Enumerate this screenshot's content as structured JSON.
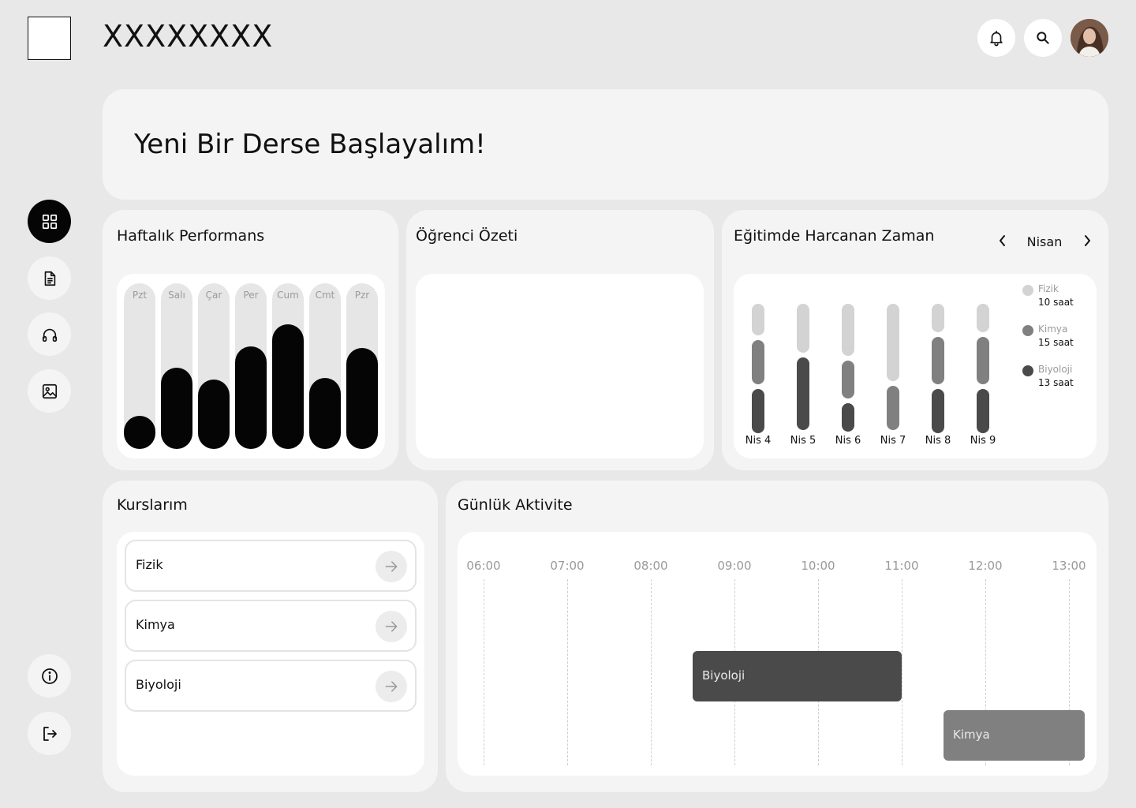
{
  "header": {
    "app_title": "XXXXXXXX",
    "icons": [
      "bell-icon",
      "search-icon"
    ]
  },
  "sidebar": {
    "items": [
      {
        "name": "dashboard",
        "icon": "grid-icon",
        "active": true
      },
      {
        "name": "documents",
        "icon": "document-icon",
        "active": false
      },
      {
        "name": "audio",
        "icon": "headphones-icon",
        "active": false
      },
      {
        "name": "gallery",
        "icon": "image-icon",
        "active": false
      }
    ],
    "bottom_items": [
      {
        "name": "info",
        "icon": "info-icon"
      },
      {
        "name": "logout",
        "icon": "logout-icon"
      }
    ]
  },
  "hero": {
    "text": "Yeni Bir Derse Başlayalım!"
  },
  "weekly_performance": {
    "title": "Haftalık Performans",
    "days": [
      "Pzt",
      "Salı",
      "Çar",
      "Per",
      "Cum",
      "Cmt",
      "Pzr"
    ],
    "values": [
      0.2,
      0.49,
      0.42,
      0.62,
      0.75,
      0.43,
      0.61
    ]
  },
  "student_summary": {
    "title": "Öğrenci Özeti"
  },
  "time_spent": {
    "title": "Eğitimde Harcanan Zaman",
    "month": "Nisan",
    "days": [
      "Nis 4",
      "Nis 5",
      "Nis 6",
      "Nis 7",
      "Nis 8",
      "Nis 9"
    ],
    "legend": [
      {
        "name": "Fizik",
        "value": "10 saat",
        "color": "#d3d3d3"
      },
      {
        "name": "Kimya",
        "value": "15 saat",
        "color": "#808080"
      },
      {
        "name": "Biyoloji",
        "value": "13 saat",
        "color": "#4a4a4a"
      }
    ]
  },
  "courses": {
    "title": "Kurslarım",
    "items": [
      "Fizik",
      "Kimya",
      "Biyoloji"
    ]
  },
  "daily_activity": {
    "title": "Günlük Aktivite",
    "times": [
      "06:00",
      "07:00",
      "08:00",
      "09:00",
      "10:00",
      "11:00",
      "12:00",
      "13:00"
    ],
    "activities": [
      {
        "label": "Biyoloji",
        "start": "08:30",
        "end": "11:00",
        "color": "#4a4a4a"
      },
      {
        "label": "Kimya",
        "start": "11:30",
        "end": "13:15",
        "color": "#808080"
      }
    ]
  }
}
